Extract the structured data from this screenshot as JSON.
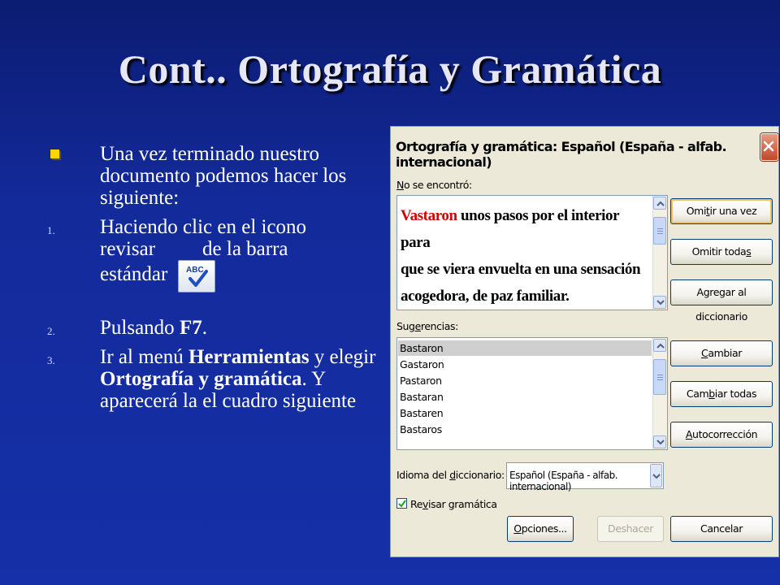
{
  "slide": {
    "title": "Cont.. Ortografía y Gramática",
    "bullets": [
      {
        "text": "Una vez terminado nuestro documento podemos hacer los siguiente:"
      },
      {
        "number": "1.",
        "line1": "Haciendo clic en el icono",
        "line2a": "revisar",
        "line2b": "de la barra",
        "line3": "estándar"
      },
      {
        "number": "2.",
        "pre": "Pulsando ",
        "bold": "F7",
        "post": "."
      },
      {
        "number": "3.",
        "pre": "Ir al menú ",
        "bold1": "Herramientas",
        "mid": " y elegir ",
        "bold2": "Ortografía y gramática",
        "post": ". Y aparecerá la el cuadro siguiente"
      }
    ],
    "icon": "spellcheck-abc-icon"
  },
  "dialog": {
    "title": "Ortografía y gramática: Español (España - alfab. internacional)",
    "not_found_label_u": "N",
    "not_found_label_rest": "o se encontró:",
    "not_found_error_word": "Vastaron",
    "not_found_line1_rest": " unos pasos por el interior para",
    "not_found_line2": "que se viera envuelta en una sensación",
    "not_found_line3": "acogedora, de paz familiar.",
    "suggestions_label_pre": "Sug",
    "suggestions_label_u": "e",
    "suggestions_label_post": "rencias:",
    "suggestions": [
      "Bastaron",
      "Gastaron",
      "Pastaron",
      "Bastaran",
      "Bastaren",
      "Bastaros"
    ],
    "selected_suggestion": "Bastaron",
    "language_label_pre": "Idioma del ",
    "language_label_u": "d",
    "language_label_post": "iccionario:",
    "language_value": "Español (España - alfab. internacional)",
    "grammar_check_pre": "Re",
    "grammar_check_u": "v",
    "grammar_check_post": "isar gramática",
    "grammar_check_checked": true,
    "buttons": {
      "ignore_once": {
        "pre": "Omi",
        "u": "t",
        "post": "ir una vez"
      },
      "ignore_all": {
        "pre": "Omitir toda",
        "u": "s",
        "post": ""
      },
      "add_dictionary": {
        "pre": "Agregar al diccionario",
        "u": "",
        "post": ""
      },
      "change": {
        "pre": "",
        "u": "C",
        "post": "ambiar"
      },
      "change_all": {
        "pre": "Cam",
        "u": "b",
        "post": "iar todas"
      },
      "autocorrect": {
        "pre": "",
        "u": "A",
        "post": "utocorrección"
      },
      "options": {
        "pre": "",
        "u": "O",
        "post": "pciones..."
      },
      "undo": {
        "pre": "Deshacer",
        "u": "",
        "post": ""
      },
      "cancel": {
        "pre": "Cancelar",
        "u": "",
        "post": ""
      }
    },
    "colors": {
      "error_word": "#d40000",
      "dialog_bg": "#ece9d8",
      "slide_bg": "#1530a8",
      "bullet": "#ffd700"
    }
  }
}
